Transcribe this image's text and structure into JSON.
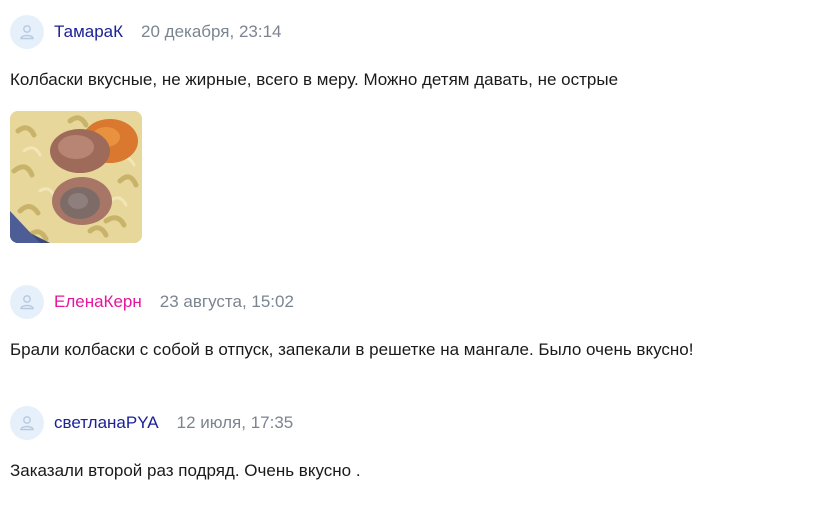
{
  "reviews": [
    {
      "author": "ТамараК",
      "author_color": "#1c2296",
      "date": "20 декабря, 23:14",
      "text": "Колбаски вкусные, не жирные, всего в меру. Можно детям давать, не острые",
      "has_photo": true
    },
    {
      "author": "ЕленаКерн",
      "author_color": "#e5159d",
      "date": "23 августа, 15:02",
      "text": "Брали колбаски с собой в отпуск, запекали в решетке на мангале. Было очень вкусно!",
      "has_photo": false
    },
    {
      "author": "светланаPYA",
      "author_color": "#1c2296",
      "date": "12 июля, 17:35",
      "text": "Заказали второй раз подряд. Очень вкусно .",
      "has_photo": false
    }
  ],
  "colors": {
    "avatar_bg": "#e6f0fb",
    "avatar_icon": "#b7c9e2",
    "date": "#7b8591",
    "text": "#1a1a1a"
  },
  "icons": {
    "avatar": "user-silhouette-icon"
  }
}
